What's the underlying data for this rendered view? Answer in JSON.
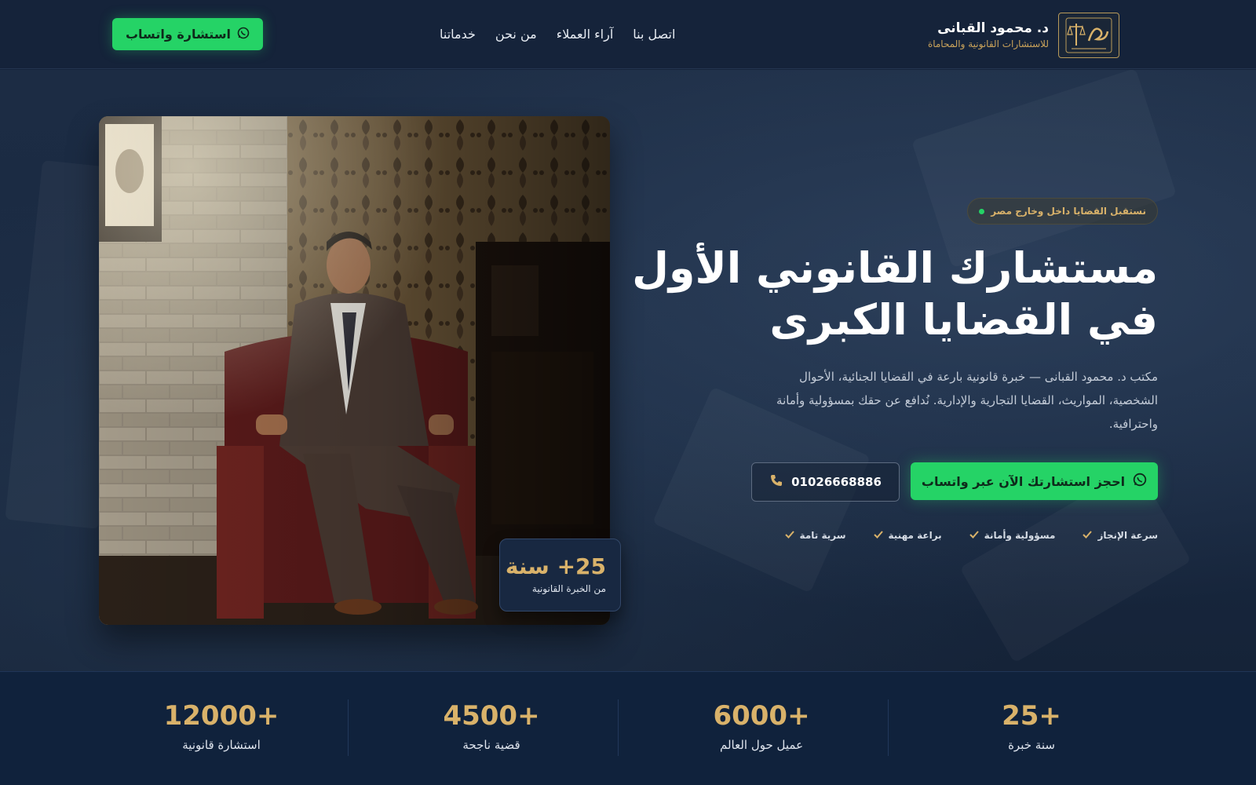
{
  "brand": {
    "name": "د. محمود القبانى",
    "subtitle": "للاستشارات القانونية والمحاماة"
  },
  "nav": {
    "items": [
      {
        "label": "خدماتنا"
      },
      {
        "label": "من نحن"
      },
      {
        "label": "آراء العملاء"
      },
      {
        "label": "اتصل بنا"
      }
    ]
  },
  "header": {
    "cta_label": "استشارة واتساب"
  },
  "hero": {
    "badge": "نستقبل القضايا داخل وخارج مصر",
    "headline_line1": "مستشارك القانوني الأول",
    "headline_line2": "في القضايا الكبرى",
    "description": "مكتب د. محمود القبانى — خبرة قانونية بارعة في القضايا الجنائية، الأحوال الشخصية، المواريث، القضايا التجارية والإدارية. نُدافع عن حقك بمسؤولية وأمانة واحترافية.",
    "cta_whatsapp": "احجز استشارتك الآن عبر واتساب",
    "cta_phone": "01026668886",
    "features": [
      {
        "label": "سرعة الإنجاز"
      },
      {
        "label": "مسؤولية وأمانة"
      },
      {
        "label": "براعة مهنية"
      },
      {
        "label": "سرية تامة"
      }
    ],
    "experience": {
      "value": "25+ سنة",
      "label": "من الخبرة القانونية"
    }
  },
  "stats": [
    {
      "value": "25+",
      "label": "سنة خبرة"
    },
    {
      "value": "6000+",
      "label": "عميل حول العالم"
    },
    {
      "value": "4500+",
      "label": "قضية ناجحة"
    },
    {
      "value": "12000+",
      "label": "استشارة قانونية"
    }
  ],
  "colors": {
    "background": "#15233a",
    "accent_gold": "#d9b26a",
    "whatsapp_green": "#25d366",
    "stats_bg": "#10223c"
  },
  "icons": {
    "logo": "scales-of-justice-logo",
    "whatsapp": "whatsapp-icon",
    "phone": "phone-icon",
    "check": "check-icon"
  }
}
